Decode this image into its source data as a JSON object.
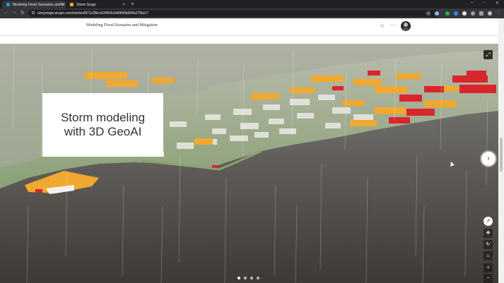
{
  "browser": {
    "tabs": [
      {
        "label": "Modeling Flood Scenarios and M",
        "close": "×",
        "favicon_color": "#1a9bb5"
      },
      {
        "label": "Storm Surge",
        "close": "×",
        "favicon_color": "#f4a61c"
      }
    ],
    "new_tab": "+",
    "url": "storymaps.arcgis.com/stories/6f71c0fbcc02f454c6d0840b054a276b/c7"
  },
  "story": {
    "title": "Modeling Flood Scenarios and Mitigation",
    "bookmark_icon": "☆",
    "more_icon": "···"
  },
  "slide": {
    "heading_line1": "Storm modeling",
    "heading_line2": "with 3D GeoAI",
    "next_arrow": "›",
    "expand_icon": "⤢"
  },
  "map_controls": {
    "compass": "➚",
    "pan": "✥",
    "rotate": "↻",
    "home": "⌂",
    "zoom_in": "+",
    "zoom_out": "−"
  },
  "carousel": {
    "count": 4,
    "active": 0
  },
  "colors": {
    "card_bg": "#ffffff",
    "water": "#4a4744",
    "roof_orange": "#f0a830",
    "roof_red": "#d9262c"
  }
}
